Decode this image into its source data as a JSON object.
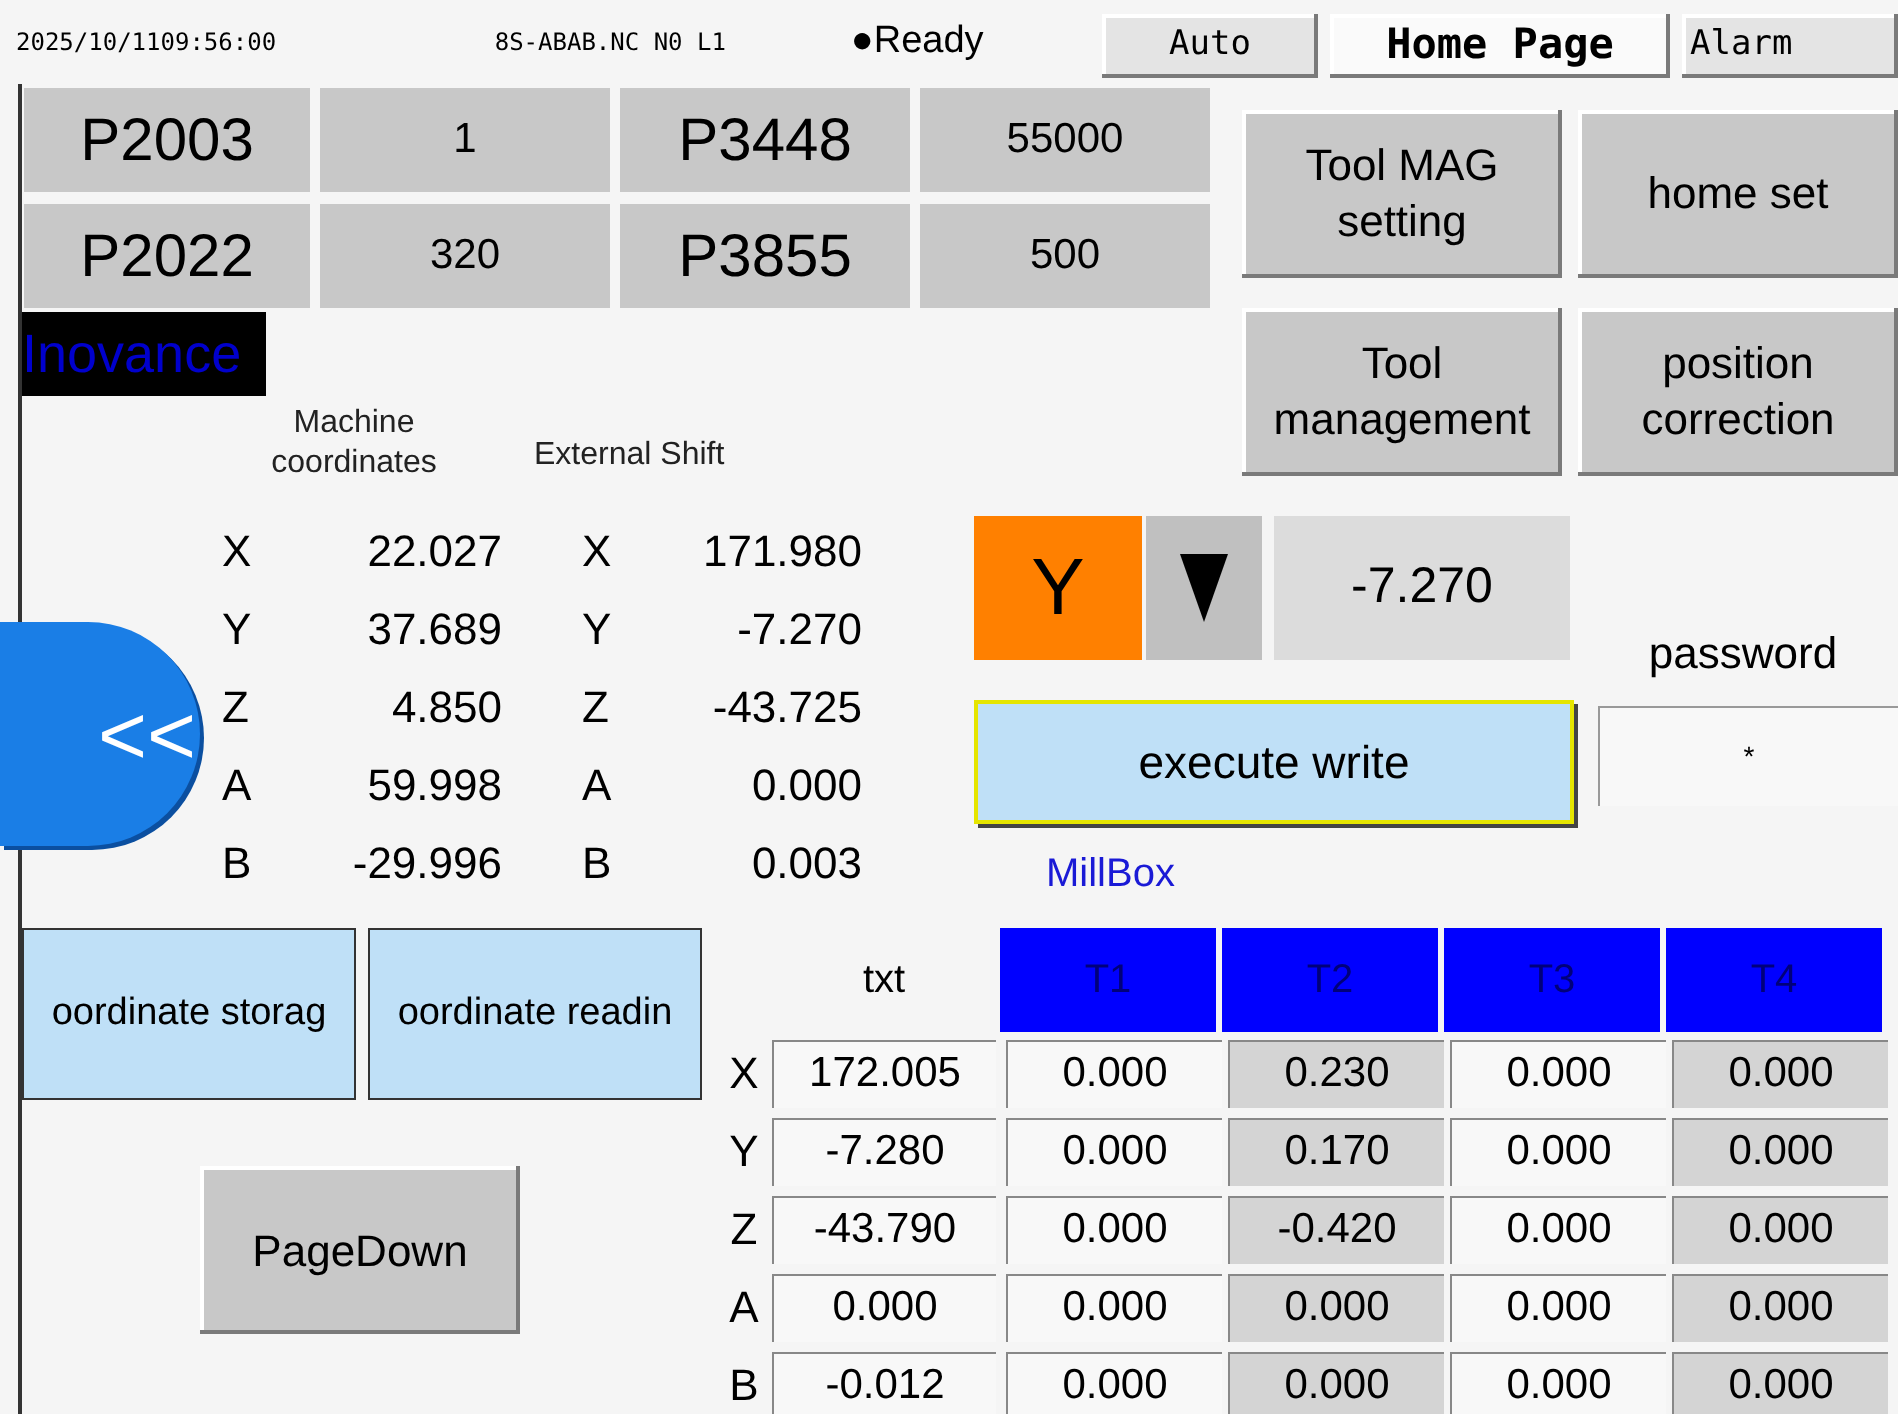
{
  "status_bar": {
    "datetime": "2025/10/1109:56:00",
    "program": "8S-ABAB.NC N0 L1",
    "state": "●Ready"
  },
  "nav_tabs": [
    {
      "label": "Auto",
      "selected": false
    },
    {
      "label": "Home Page",
      "selected": true
    },
    {
      "label": "Alarm",
      "selected": false
    }
  ],
  "params": [
    {
      "name": "P2003",
      "value": "1"
    },
    {
      "name": "P3448",
      "value": "55000"
    },
    {
      "name": "P2022",
      "value": "320"
    },
    {
      "name": "P3855",
      "value": "500"
    }
  ],
  "function_buttons": [
    "Tool MAG setting",
    "home set",
    "Tool management",
    "position correction"
  ],
  "logo": "Inovance",
  "coordinates": {
    "machine_header": "Machine coordinates",
    "shift_header": "External Shift",
    "rows": [
      {
        "axis": "X",
        "value": "22.027",
        "shift_axis": "X",
        "shift_value": "171.980"
      },
      {
        "axis": "Y",
        "value": "37.689",
        "shift_axis": "Y",
        "shift_value": "-7.270"
      },
      {
        "axis": "Z",
        "value": "4.850",
        "shift_axis": "Z",
        "shift_value": "-43.725"
      },
      {
        "axis": "A",
        "value": "59.998",
        "shift_axis": "A",
        "shift_value": "0.000"
      },
      {
        "axis": "B",
        "value": "-29.996",
        "shift_axis": "B",
        "shift_value": "0.003"
      }
    ]
  },
  "back_button": "<<",
  "axis_select": {
    "axis": "Y",
    "value": "-7.270"
  },
  "execute_button": "execute write",
  "password": {
    "label": "password",
    "value": "*"
  },
  "side_buttons": [
    "oordinate storag",
    "oordinate readin"
  ],
  "page_down": "PageDown",
  "millbox": {
    "title": "MillBox",
    "txt_header": "txt",
    "columns": [
      {
        "label": "T1",
        "shaded": false
      },
      {
        "label": "T2",
        "shaded": true
      },
      {
        "label": "T3",
        "shaded": false
      },
      {
        "label": "T4",
        "shaded": true
      }
    ],
    "rows": [
      {
        "axis": "X",
        "txt": "172.005",
        "values": [
          "0.000",
          "0.230",
          "0.000",
          "0.000"
        ]
      },
      {
        "axis": "Y",
        "txt": "-7.280",
        "values": [
          "0.000",
          "0.170",
          "0.000",
          "0.000"
        ]
      },
      {
        "axis": "Z",
        "txt": "-43.790",
        "values": [
          "0.000",
          "-0.420",
          "0.000",
          "0.000"
        ]
      },
      {
        "axis": "A",
        "txt": "0.000",
        "values": [
          "0.000",
          "0.000",
          "0.000",
          "0.000"
        ]
      },
      {
        "axis": "B",
        "txt": "-0.012",
        "values": [
          "0.000",
          "0.000",
          "0.000",
          "0.000"
        ]
      }
    ]
  }
}
